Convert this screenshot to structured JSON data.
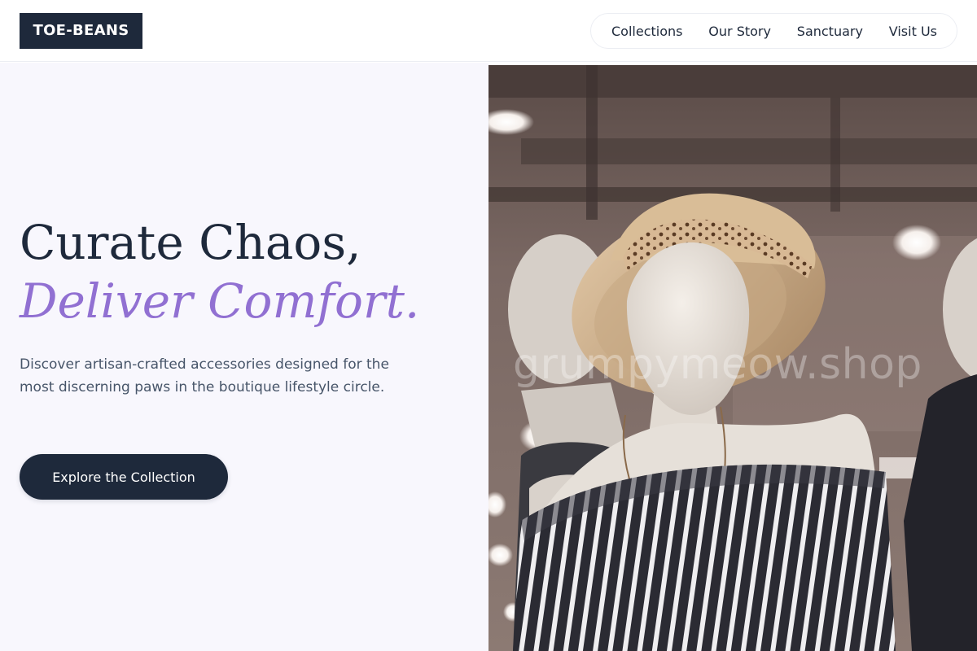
{
  "brand": {
    "logo_text": "TOE-BEANS"
  },
  "nav": {
    "items": [
      {
        "label": "Collections"
      },
      {
        "label": "Our Story"
      },
      {
        "label": "Sanctuary"
      },
      {
        "label": "Visit Us"
      }
    ]
  },
  "hero": {
    "headline_line1": "Curate Chaos,",
    "headline_line2": "Deliver Comfort.",
    "subtext": "Discover artisan-crafted accessories designed for the most discerning paws in the boutique lifestyle circle.",
    "cta_label": "Explore the Collection",
    "image_watermark": "grumpymeow.shop"
  },
  "colors": {
    "primary": "#1e293b",
    "accent": "#9170d2",
    "hero_bg": "#f8f7fd",
    "body_text": "#475569"
  }
}
